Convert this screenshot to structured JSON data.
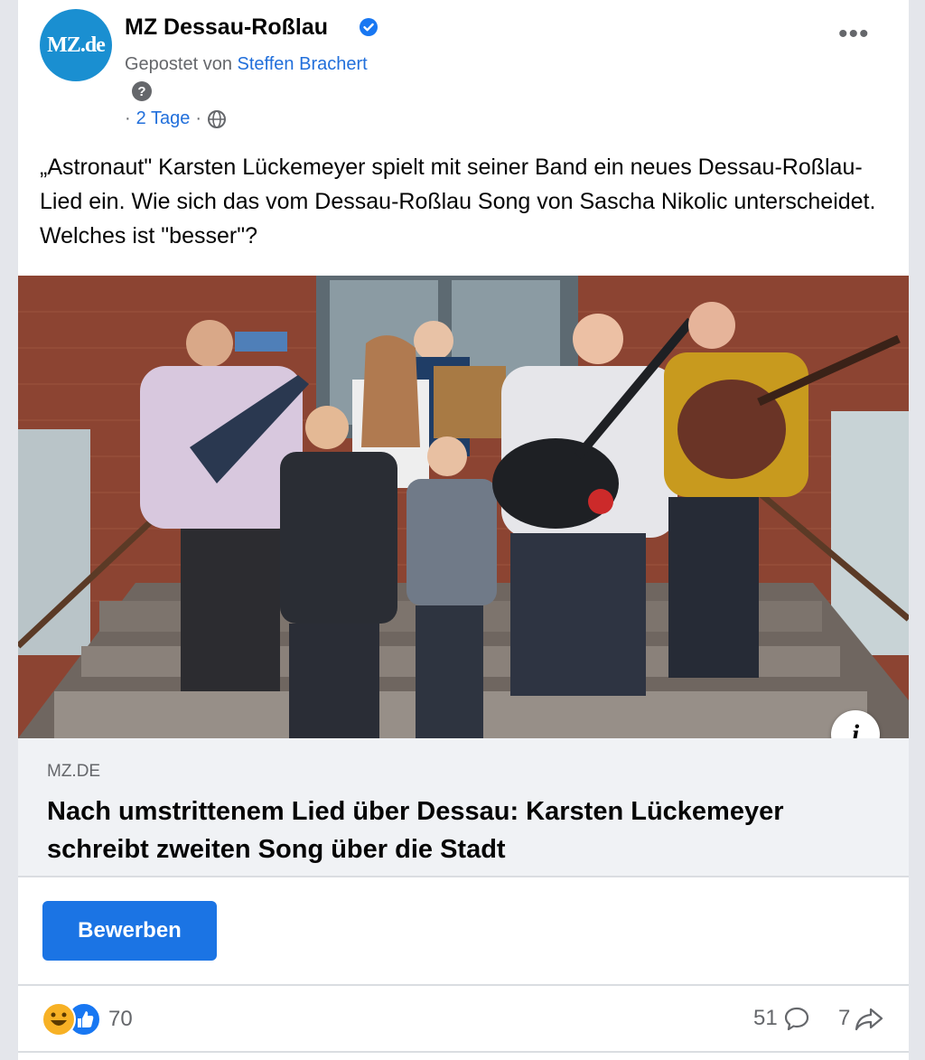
{
  "post": {
    "page_name": "MZ Dessau-Roßlau",
    "avatar_text": "MZ.de",
    "posted_by_prefix": "Gepostet von",
    "author": "Steffen Brachert",
    "time": "2 Tage",
    "text": "„Astronaut\" Karsten Lückemeyer spielt mit seiner Band ein neues Dessau-Roßlau-Lied ein. Wie sich das vom Dessau-Roßlau Song von Sascha Nikolic unterscheidet. Welches ist \"besser\"?"
  },
  "link": {
    "domain": "MZ.DE",
    "title": "Nach umstrittenem Lied über Dessau: Karsten Lückemeyer schreibt zweiten Song über die Stadt",
    "info_icon": "i"
  },
  "cta": {
    "label": "Bewerben"
  },
  "engagement": {
    "reactions_count": "70",
    "comments_count": "51",
    "shares_count": "7"
  },
  "colors": {
    "accent": "#1b74e4",
    "link_text": "#216fdb",
    "secondary_text": "#65676b",
    "avatar_bg": "#1a8fd1"
  },
  "icons": {
    "verified": "verified-badge-icon",
    "help": "question-icon",
    "globe": "globe-icon",
    "more": "more-options-icon",
    "comment": "comment-icon",
    "share": "share-icon",
    "haha": "haha-reaction-icon",
    "like": "like-reaction-icon"
  }
}
